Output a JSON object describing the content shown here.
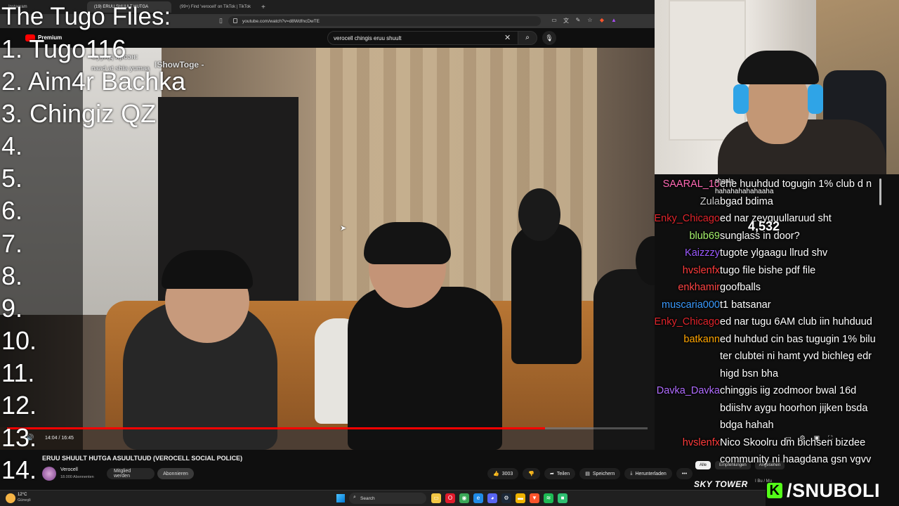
{
  "browser": {
    "tabs": [
      {
        "label": "Instagram",
        "active": false
      },
      {
        "label": "(19) ERUU SHUULT HUTGA",
        "active": true
      },
      {
        "label": "(99+) Find 'verocell' on TikTok | TikTok",
        "active": false
      }
    ],
    "new_tab_label": "+",
    "url": "youtube.com/watch?v=d8WdfncDwTE"
  },
  "youtube": {
    "logo_text": "Premium",
    "search_value": "verocell chingis eruu shuult",
    "video_title": "ERUU SHUULT HUTGA ASUULTUUD (VEROCELL SOCIAL POLICE)",
    "channel_name": "Verocell",
    "channel_subs": "18.000 Abonnenten",
    "join_label": "Mitglied werden",
    "subscribe_label": "Abonnieren",
    "likes": "3003",
    "share_label": "Teilen",
    "save_label": "Speichern",
    "download_label": "Herunterladen",
    "more_label": "•••",
    "time_display": "14:04 / 16:45",
    "progress_fraction": 0.84,
    "filter_chips": [
      "Alle",
      "Empfehlungen",
      "Angesehen"
    ],
    "sidebar_promo": "SKY TOWER",
    "sidebar_promo_sub": "I Bu / Mu"
  },
  "video_overlay": {
    "header": "Суулд ирсэн:",
    "name": "IShowToge -",
    "sub": "naad at shia yumaa"
  },
  "tugo_files": {
    "title": "The Tugo Files:",
    "items": [
      "1. Tugo116",
      "2. Aim4r Bachka",
      "3. Chingiz QZ",
      "4.",
      "5.",
      "6.",
      "7.",
      "8.",
      "9.",
      "10.",
      "11.",
      "12.",
      "13.",
      "14."
    ]
  },
  "chat": {
    "viewers": "4,532",
    "floating_text_1": "shaala",
    "floating_text_2": "hahahahahahaaha",
    "messages": [
      {
        "user": "SAARAL_10",
        "color": "#ff69b4",
        "text": "ehe huuhdud togugin 1% club d n"
      },
      {
        "user": "Zula",
        "color": "#cccccc",
        "text": "bgad bdima"
      },
      {
        "user": "Enky_Chicago",
        "color": "#e0242b",
        "text": "ed nar zeyguullaruud sht"
      },
      {
        "user": "blub69",
        "color": "#a6f36c",
        "text": "sunglass in door?"
      },
      {
        "user": "Kaizzzy",
        "color": "#9b59ff",
        "text": "tugote ylgaagu llrud shv"
      },
      {
        "user": "hvslenfx",
        "color": "#ff3b3b",
        "text": "tugo file bishe pdf file"
      },
      {
        "user": "enkhamir",
        "color": "#ff4444",
        "text": "goofballs"
      },
      {
        "user": "muscaria000",
        "color": "#3a9bff",
        "text": "t1 batsanar"
      },
      {
        "user": "Enky_Chicago",
        "color": "#e0242b",
        "text": "ed nar tugu 6AM club iin huhduud"
      },
      {
        "user": "batkann",
        "color": "#ffa500",
        "text": "ed huhdud cin bas tugugin 1% bilu"
      },
      {
        "user": "",
        "color": "#ffffff",
        "text": "ter clubtei ni hamt yvd bichleg edr"
      },
      {
        "user": "",
        "color": "#ffffff",
        "text": "higd bsn bha"
      },
      {
        "user": "Davka_Davka",
        "color": "#b06cff",
        "text": "chinggis iig zodmoor bwal 16d"
      },
      {
        "user": "",
        "color": "#ffffff",
        "text": "bdiishv aygu hoorhon jijken bsda"
      },
      {
        "user": "",
        "color": "#ffffff",
        "text": "bdga hahah"
      },
      {
        "user": "hvslenfx",
        "color": "#ff3b3b",
        "text": "Nico Skoolru dm bichsen bizdee"
      },
      {
        "user": "",
        "color": "#ffffff",
        "text": "community ni haagdana gsn vgvv"
      }
    ]
  },
  "brand": {
    "kick_letter": "K",
    "handle": "/SNUBOLI"
  },
  "taskbar": {
    "temp": "12°C",
    "weather": "Güneşli",
    "search_label": "Search",
    "apps": [
      {
        "name": "files-icon",
        "color": "#f2c744",
        "glyph": "▭"
      },
      {
        "name": "opera-icon",
        "color": "#e01a2b",
        "glyph": "O"
      },
      {
        "name": "chrome-icon",
        "color": "#3aa757",
        "glyph": "◉"
      },
      {
        "name": "edge-icon",
        "color": "#1f8ae6",
        "glyph": "e"
      },
      {
        "name": "discord-icon",
        "color": "#5865f2",
        "glyph": "◕"
      },
      {
        "name": "steam-icon",
        "color": "#1b2838",
        "glyph": "⚙"
      },
      {
        "name": "folder-icon",
        "color": "#f0b400",
        "glyph": "▬"
      },
      {
        "name": "brave-icon",
        "color": "#fb542b",
        "glyph": "▼"
      },
      {
        "name": "spotify-icon",
        "color": "#1db954",
        "glyph": "≋"
      },
      {
        "name": "app-icon",
        "color": "#2fbf71",
        "glyph": "■"
      }
    ]
  }
}
